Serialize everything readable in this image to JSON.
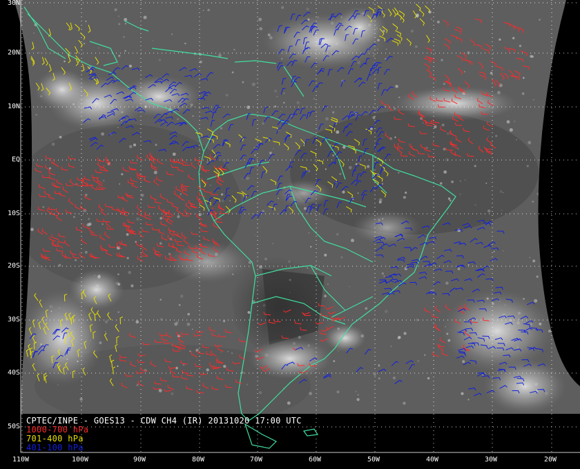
{
  "title": "CPTEC/INPE - GOES13 - CDW CH4 (IR) 20131020 17:00 UTC",
  "legend": [
    {
      "label": "1000-700 hPa",
      "color": "#ff2a2a"
    },
    {
      "label": "701-400 hPa",
      "color": "#e8e000"
    },
    {
      "label": "401-100 hPa",
      "color": "#1020e0"
    }
  ],
  "latitude_labels": [
    "30N",
    "20N",
    "10N",
    "EQ",
    "10S",
    "20S",
    "30S",
    "40S",
    "50S"
  ],
  "longitude_labels": [
    "110W",
    "100W",
    "90W",
    "80W",
    "70W",
    "60W",
    "50W",
    "40W",
    "30W",
    "20W"
  ],
  "colors": {
    "coastline": "#3fe0a0",
    "grid": "#ffffff",
    "space": "#000000"
  }
}
